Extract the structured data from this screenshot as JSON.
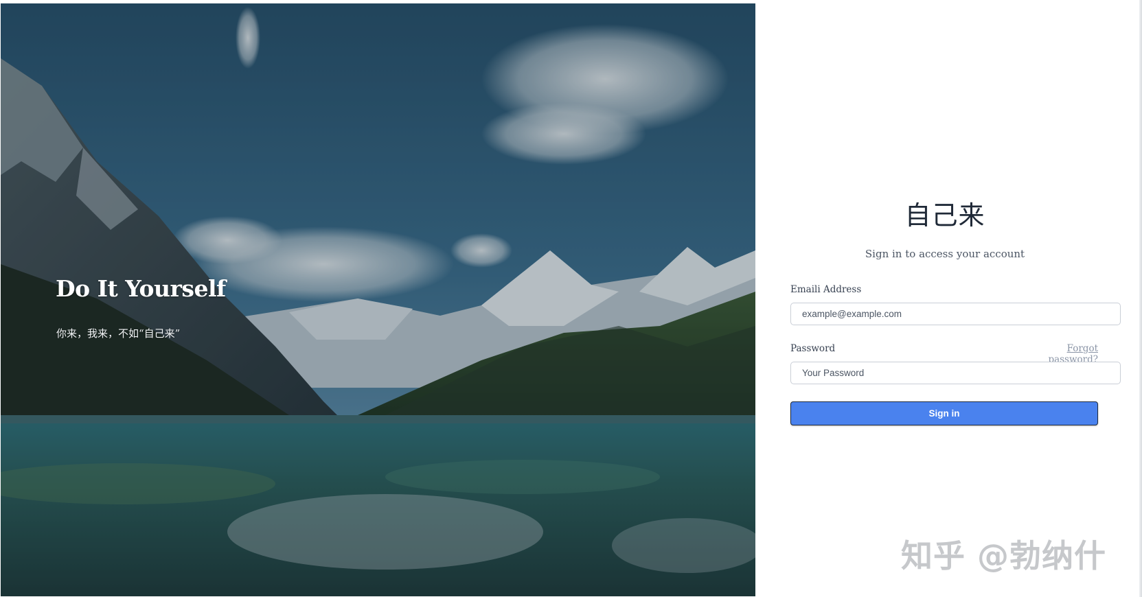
{
  "hero": {
    "title": "Do It Yourself",
    "subtitle": "你来，我来，不如“自己来”"
  },
  "login": {
    "brand": "自己来",
    "tagline": "Sign in to access your account",
    "email": {
      "label": "Emaili Address",
      "placeholder": "example@example.com",
      "value": ""
    },
    "password": {
      "label": "Password",
      "placeholder": "Your Password",
      "value": "",
      "forgot_label": "Forgot password?"
    },
    "signin_label": "Sign in"
  },
  "watermark": "知乎 @勃纳什",
  "colors": {
    "accent": "#4a82ee",
    "title_text": "#1f2937",
    "link_text": "#8a94a6"
  }
}
